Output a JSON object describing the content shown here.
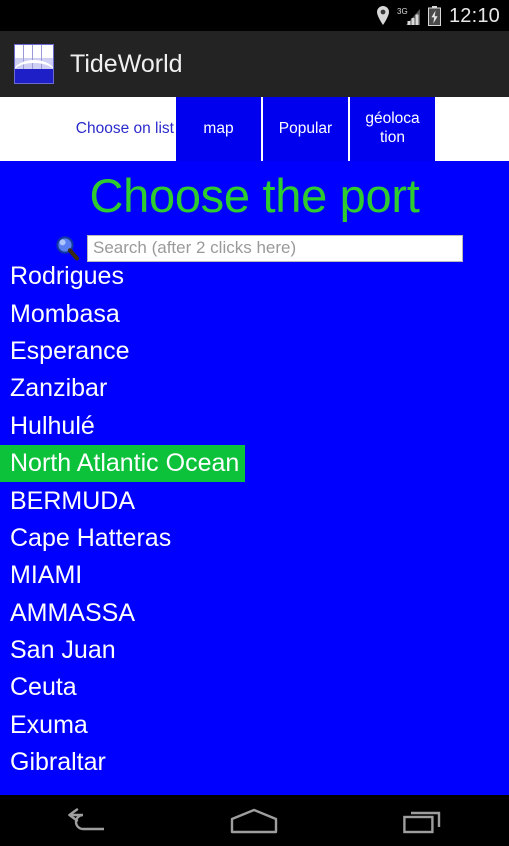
{
  "status_bar": {
    "time": "12:10",
    "icons": [
      "location-pin-icon",
      "signal-3g-icon",
      "battery-charging-icon"
    ],
    "network_label": "3G",
    "background": "#000000"
  },
  "action_bar": {
    "app_icon": "tideworld-app-icon",
    "title": "TideWorld",
    "background": "#232323"
  },
  "tabs": {
    "inactive_label": "Choose on list",
    "items": [
      {
        "label": "map",
        "name": "tab-map"
      },
      {
        "label": "Popular",
        "name": "tab-popular"
      },
      {
        "label": "géoloca\ntion",
        "name": "tab-geolocation"
      }
    ],
    "active_background": "#0000ee",
    "inactive_text_color": "#2b2bcc"
  },
  "main": {
    "title": "Choose the port",
    "title_color": "#2ecc2e",
    "background": "#0000ff",
    "search": {
      "icon": "magnifier-icon",
      "placeholder": "Search (after 2 clicks here)",
      "value": ""
    },
    "selected_port": "North Atlantic Ocean",
    "selected_highlight_color": "#0cc23a",
    "ports": [
      {
        "label": "Rodrigues",
        "selected": false
      },
      {
        "label": "Mombasa",
        "selected": false
      },
      {
        "label": "Esperance",
        "selected": false
      },
      {
        "label": "Zanzibar",
        "selected": false
      },
      {
        "label": "Hulhulé",
        "selected": false
      },
      {
        "label": "North Atlantic Ocean",
        "selected": true
      },
      {
        "label": "BERMUDA",
        "selected": false
      },
      {
        "label": "Cape Hatteras",
        "selected": false
      },
      {
        "label": "MIAMI",
        "selected": false
      },
      {
        "label": "AMMASSA",
        "selected": false
      },
      {
        "label": "San Juan",
        "selected": false
      },
      {
        "label": "Ceuta",
        "selected": false
      },
      {
        "label": "Exuma",
        "selected": false
      },
      {
        "label": "Gibraltar",
        "selected": false
      }
    ]
  },
  "nav_bar": {
    "buttons": [
      {
        "name": "nav-back-button",
        "icon": "back-arrow-icon"
      },
      {
        "name": "nav-home-button",
        "icon": "home-icon"
      },
      {
        "name": "nav-recents-button",
        "icon": "recents-icon"
      }
    ],
    "background": "#000000"
  }
}
